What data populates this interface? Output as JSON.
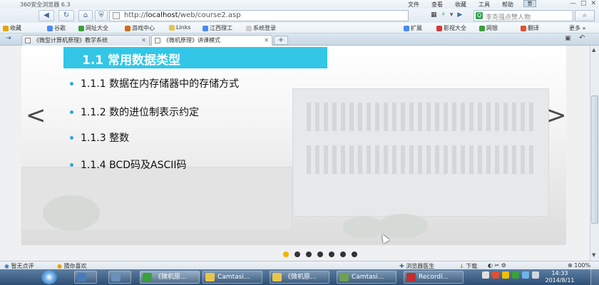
{
  "browser": {
    "title": "360安全浏览器 6.3",
    "menu": [
      "文件",
      "查看",
      "收藏",
      "工具",
      "帮助"
    ],
    "skin_label": "皆",
    "window_controls": [
      "—",
      "□",
      "✕"
    ],
    "url_prefix": "http://",
    "url_host": "localhost",
    "url_path": "/web/course2.asp",
    "search_value": "李克强点赞人物",
    "bookmarks_left": [
      {
        "label": "收藏",
        "icon": "star-icon",
        "color": "#e8a400"
      },
      {
        "label": "谷歌",
        "icon": "google-icon",
        "color": "#4a8af4"
      },
      {
        "label": "网址大全",
        "icon": "url-nav-icon",
        "color": "#3aa03a"
      },
      {
        "label": "游戏中心",
        "icon": "game-icon",
        "color": "#d46a1a"
      },
      {
        "label": "Links",
        "icon": "folder-icon",
        "color": "#e8c54a"
      },
      {
        "label": "江西理工",
        "icon": "page-icon",
        "color": "#4a8af4"
      },
      {
        "label": "系统登录",
        "icon": "page-icon",
        "color": "#cccccc"
      }
    ],
    "bookmarks_right": [
      {
        "label": "扩展",
        "icon": "extension-icon",
        "color": "#4a8af4"
      },
      {
        "label": "影视大全",
        "icon": "video-icon",
        "color": "#d43a3a"
      },
      {
        "label": "网银",
        "icon": "bank-icon",
        "color": "#3aa03a"
      },
      {
        "label": "翻译",
        "icon": "translate-icon",
        "color": "#e05030"
      },
      {
        "label": "更多 »",
        "icon": "",
        "color": ""
      }
    ],
    "tabs": [
      {
        "label": "《微型计算机原理》教学系统",
        "active": false
      },
      {
        "label": "《微机原理》讲课模式",
        "active": true
      }
    ],
    "new_tab": "+"
  },
  "slide": {
    "title": "1.1 常用数据类型",
    "items": [
      "1.1.1 数据在内存储器中的存储方式",
      "1.1.2 数的进位制表示约定",
      "1.1.3 整数",
      "1.1.4 BCD码及ASCII码"
    ],
    "prev_arrow": "<",
    "next_arrow": ">",
    "dot_count": 7,
    "active_dot": 0
  },
  "statusbar": {
    "left1": "暂无点评",
    "left2": "猜你喜欢",
    "doctor": "浏览器医生",
    "download": "下载",
    "zoom": "100%"
  },
  "taskbar": {
    "items": [
      {
        "label": "",
        "color": "#4a7ab8"
      },
      {
        "label": "",
        "color": "#6a8fb8"
      },
      {
        "label": "《微机原...",
        "color": "#3aa03a"
      },
      {
        "label": "Camtasi...",
        "color": "#e8c54a"
      },
      {
        "label": "《微机原...",
        "color": "#e8c54a"
      },
      {
        "label": "Camtasi...",
        "color": "#6fa050"
      },
      {
        "label": "Recordi...",
        "color": "#c03030"
      }
    ],
    "time": "14:33",
    "date": "2014/8/11"
  }
}
